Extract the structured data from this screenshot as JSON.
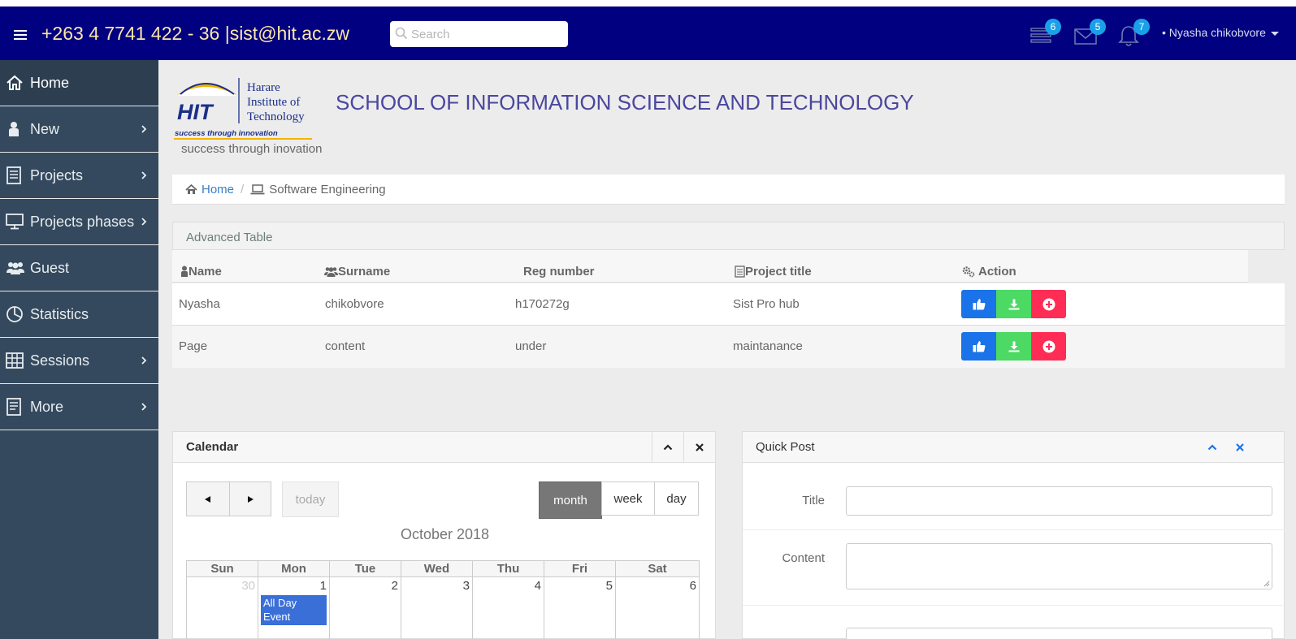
{
  "header": {
    "contact": "+263 4 7741 422 - 36 |sist@hit.ac.zw",
    "search_placeholder": "Search",
    "badges": {
      "tasks": "6",
      "messages": "5",
      "notifications": "7"
    },
    "user_name": "• Nyasha chikobvore"
  },
  "sidebar": {
    "items": [
      {
        "label": "Home"
      },
      {
        "label": "New"
      },
      {
        "label": "Projects"
      },
      {
        "label": "Projects phases"
      },
      {
        "label": "Guest"
      },
      {
        "label": "Statistics"
      },
      {
        "label": "Sessions"
      },
      {
        "label": "More"
      }
    ]
  },
  "logo": {
    "brand": "HIT",
    "line1": "Harare",
    "line2": "Institute of",
    "line3": "Technology",
    "motto": "success through innovation"
  },
  "tagline": "success through inovation",
  "school_title": "SCHOOL OF INFORMATION SCIENCE AND TECHNOLOGY",
  "breadcrumb": {
    "home": "Home",
    "current": "Software Engineering"
  },
  "table": {
    "title": "Advanced Table",
    "columns": [
      "Name",
      "Surname",
      "Reg number",
      "Project title",
      "Action"
    ],
    "rows": [
      [
        "Nyasha",
        "chikobvore",
        "h170272g",
        "Sist Pro hub"
      ],
      [
        "Page",
        "content",
        "under",
        "maintanance"
      ]
    ]
  },
  "calendar": {
    "title": "Calendar",
    "today_label": "today",
    "views": [
      "month",
      "week",
      "day"
    ],
    "month_title": "October 2018",
    "weekdays": [
      "Sun",
      "Mon",
      "Tue",
      "Wed",
      "Thu",
      "Fri",
      "Sat"
    ],
    "days": [
      "30",
      "1",
      "2",
      "3",
      "4",
      "5",
      "6"
    ],
    "event": "All Day Event"
  },
  "quick_post": {
    "title": "Quick Post",
    "fields": [
      "Title",
      "Content"
    ]
  },
  "colors": {
    "header": "#000080",
    "sidebar": "#34495e",
    "accent_title": "#4a479e",
    "like": "#1a73e8",
    "download": "#4cd964",
    "remove": "#ff2d55"
  }
}
